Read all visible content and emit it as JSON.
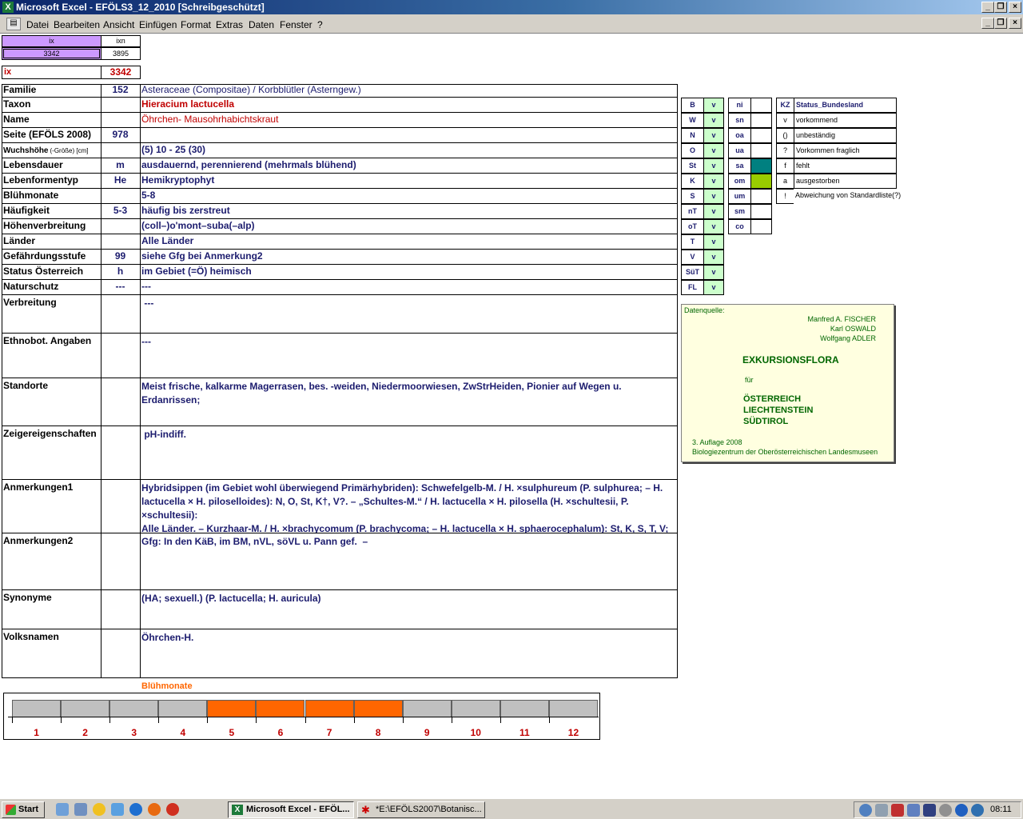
{
  "window": {
    "title": "Microsoft Excel - EFÖLS3_12_2010  [Schreibgeschützt]"
  },
  "menu": [
    "Datei",
    "Bearbeiten",
    "Ansicht",
    "Einfügen",
    "Format",
    "Extras",
    "Daten",
    "Fenster",
    "?"
  ],
  "topcells": {
    "ix_label": "ix",
    "ixn_label": "ixn",
    "ix_value": "3342",
    "ixn_value": "3895",
    "ix_red_label": "ix",
    "ix_red_value": "3342"
  },
  "rows": [
    {
      "label": "Familie",
      "code": "152",
      "text": "Asteraceae (Compositae)  /  Korbblütler (Asterngew.)"
    },
    {
      "label": "Taxon",
      "code": "",
      "text": "Hieracium lactucella"
    },
    {
      "label": "Name",
      "code": "",
      "text": "Öhrchen- Mausohrhabichtskraut"
    },
    {
      "label": "Seite (EFÖLS 2008)",
      "code": "978",
      "text": ""
    },
    {
      "label": "Wuchshöhe",
      "label_small": "(-Größe) [cm]",
      "code": "",
      "text": " (5) 10 - 25 (30)"
    },
    {
      "label": "Lebensdauer",
      "code": "m",
      "text": "ausdauernd, perennierend (mehrmals blühend)"
    },
    {
      "label": "Lebenformentyp",
      "code": "He",
      "text": "Hemikryptophyt"
    },
    {
      "label": "Blühmonate",
      "code": "",
      "text": " 5-8"
    },
    {
      "label": "Häufigkeit",
      "code": "5-3",
      "text": "häufig bis zerstreut"
    },
    {
      "label": "Höhenverbreitung",
      "code": "",
      "text": "(coll–)o'mont–suba(–alp)"
    },
    {
      "label": "Länder",
      "code": "",
      "text": "Alle Länder"
    },
    {
      "label": "Gefährdungsstufe",
      "code": "99",
      "text": "siehe Gfg bei Anmerkung2"
    },
    {
      "label": "Status Österreich",
      "code": "h",
      "text": "im Gebiet (=Ö) heimisch"
    },
    {
      "label": "Naturschutz",
      "code": "---",
      "text": " ---"
    }
  ],
  "bigrows": [
    {
      "label": "Verbreitung",
      "text": " ---"
    },
    {
      "label": "Ethnobot. Angaben",
      "text": "---"
    },
    {
      "label": "Standorte",
      "text": "Meist frische, kalkarme Magerrasen, bes. -weiden, Niedermoorwiesen, ZwStrHeiden, Pionier auf Wegen u.\nErdanrissen;"
    },
    {
      "label": "Zeigereigenschaften",
      "text": " pH-indiff."
    },
    {
      "label": "Anmerkungen1",
      "text": "Hybridsippen (im Gebiet wohl überwiegend Primärhybriden): Schwefelgelb-M. / H. ×sulphureum (P. sulphurea; – H.\nlactucella × H. piloselloides): N, O, St, K†, V?. – „Schultes-M.“ / H. lactucella × H. pilosella (H. ×schultesii, P. ×schultesii):\nAlle Länder. – Kurzhaar-M. / H. ×brachycomum (P. brachycoma; – H. lactucella × H. sphaerocephalum): St, K, S, T, V;\nSüdT. – Verborgen-M., (it.:) Sparviere nascosto / H. ×lathraeum (P. lathraea; – H. brachy-co-mum ×> H. hoppeanum): N-"
    },
    {
      "label": "Anmerkungen2",
      "text": "Gfg: In den KäB, im BM, nVL, söVL u. Pann gef.  –"
    },
    {
      "label": "Synonyme",
      "text": "(HA; sexuell.) (P. lactucella; H. auricula)"
    },
    {
      "label": "Volksnamen",
      "text": "Öhrchen-H."
    }
  ],
  "states": [
    {
      "code": "B",
      "v": "v"
    },
    {
      "code": "W",
      "v": "v"
    },
    {
      "code": "N",
      "v": "v"
    },
    {
      "code": "O",
      "v": "v"
    },
    {
      "code": "St",
      "v": "v"
    },
    {
      "code": "K",
      "v": "v"
    },
    {
      "code": "S",
      "v": "v"
    },
    {
      "code": "nT",
      "v": "v"
    },
    {
      "code": "oT",
      "v": "v"
    },
    {
      "code": "T",
      "v": "v"
    },
    {
      "code": "V",
      "v": "v"
    },
    {
      "code": "SüT",
      "v": "v"
    },
    {
      "code": "FL",
      "v": "v"
    }
  ],
  "regions": [
    "ni",
    "sn",
    "oa",
    "ua",
    "sa",
    "om",
    "um",
    "sm",
    "co"
  ],
  "status_legend": {
    "kz": "KZ",
    "title": "Status_Bundesland",
    "items": [
      {
        "k": "v",
        "t": "vorkommend"
      },
      {
        "k": "()",
        "t": "unbeständig"
      },
      {
        "k": "?",
        "t": "Vorkommen fraglich"
      },
      {
        "k": "f",
        "t": "fehlt"
      },
      {
        "k": "a",
        "t": "ausgestorben"
      },
      {
        "k": "!",
        "t": "Abweichung von Standardliste(?)"
      }
    ]
  },
  "datasource": {
    "heading": "Datenquelle:",
    "authors": [
      "Manfred A. FISCHER",
      "Karl OSWALD",
      "Wolfgang ADLER"
    ],
    "title": "EXKURSIONSFLORA",
    "fuer": "für",
    "countries": [
      "ÖSTERREICH",
      "LIECHTENSTEIN",
      "SÜDTIROL"
    ],
    "edition": "3. Auflage 2008",
    "publisher": "Biologiezentrum der Oberösterreichischen Landesmuseen"
  },
  "bloom": {
    "title": "Blühmonate",
    "months": [
      "1",
      "2",
      "3",
      "4",
      "5",
      "6",
      "7",
      "8",
      "9",
      "10",
      "11",
      "12"
    ],
    "active": [
      false,
      false,
      false,
      false,
      true,
      true,
      true,
      true,
      false,
      false,
      false,
      false
    ],
    "colors": {
      "active": "#ff6600",
      "inactive": "#c0c0c0"
    }
  },
  "taskbar": {
    "start": "Start",
    "tasks": [
      "Microsoft Excel - EFÖL...",
      "*E:\\EFÖLS2007\\Botanisc..."
    ],
    "clock": "08:11"
  }
}
